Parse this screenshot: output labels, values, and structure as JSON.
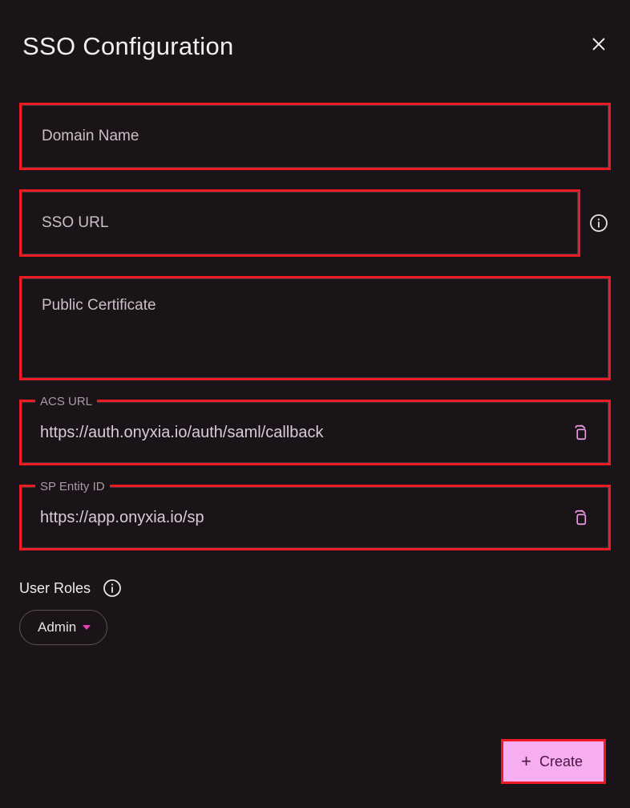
{
  "dialog": {
    "title": "SSO Configuration"
  },
  "fields": {
    "domain_name": {
      "placeholder": "Domain Name",
      "value": ""
    },
    "sso_url": {
      "placeholder": "SSO URL",
      "value": ""
    },
    "public_cert": {
      "placeholder": "Public Certificate",
      "value": ""
    },
    "acs_url": {
      "label": "ACS URL",
      "value": "https://auth.onyxia.io/auth/saml/callback"
    },
    "sp_entity": {
      "label": "SP Entity ID",
      "value": "https://app.onyxia.io/sp"
    }
  },
  "roles": {
    "label": "User Roles",
    "selected": "Admin"
  },
  "actions": {
    "create": "Create"
  },
  "colors": {
    "highlight": "#ed1c24",
    "accent": "#f7aef0",
    "accent_caret": "#ea3fb8",
    "copy_icon": "#e99ee5"
  }
}
